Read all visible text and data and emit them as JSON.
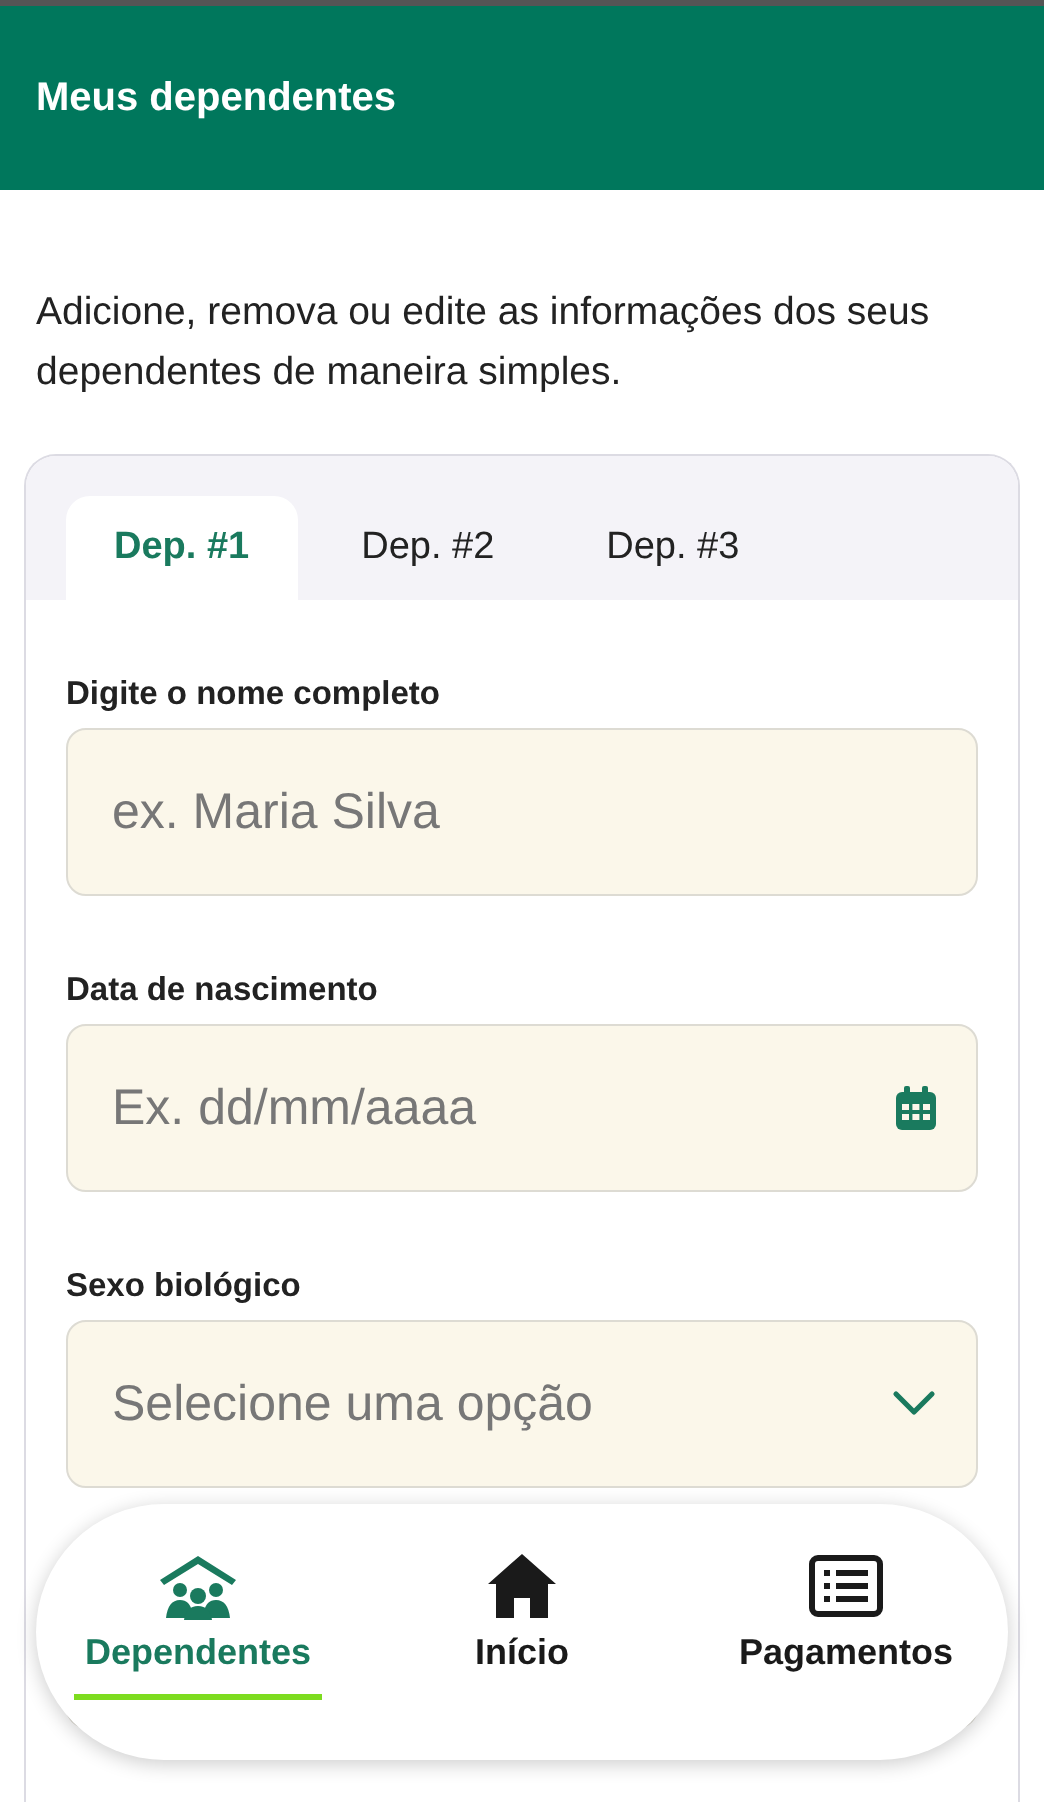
{
  "header": {
    "title": "Meus dependentes"
  },
  "description": "Adicione, remova ou edite as informações dos seus dependentes de maneira simples.",
  "tabs": [
    {
      "label": "Dep. #1",
      "selected": true
    },
    {
      "label": "Dep. #2",
      "selected": false
    },
    {
      "label": "Dep. #3",
      "selected": false
    }
  ],
  "fields": [
    {
      "kind": "text",
      "label": "Digite o nome completo",
      "placeholder": "ex. Maria Silva"
    },
    {
      "kind": "date",
      "label": "Data de nascimento",
      "placeholder": "Ex. dd/mm/aaaa"
    },
    {
      "kind": "select",
      "label": "Sexo biológico",
      "placeholder": "Selecione uma opção"
    }
  ],
  "bottom_nav": [
    {
      "kind": "dependents",
      "label": "Dependentes",
      "selected": true
    },
    {
      "kind": "home",
      "label": "Início",
      "selected": false
    },
    {
      "kind": "payments",
      "label": "Pagamentos",
      "selected": false
    }
  ]
}
